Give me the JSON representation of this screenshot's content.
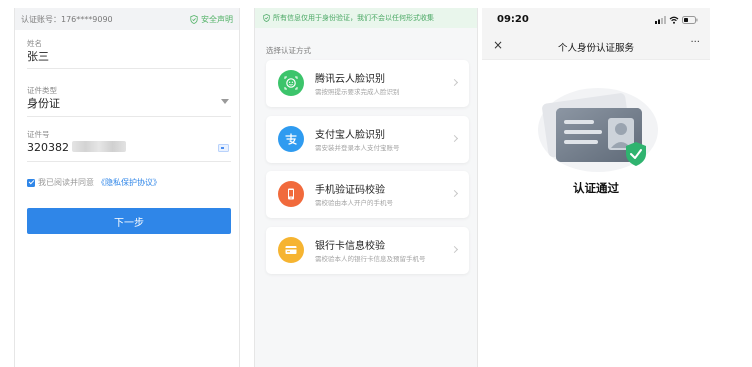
{
  "form": {
    "account_label": "认证账号：",
    "account_value": "176****9090",
    "security_notice": "安全声明",
    "name": {
      "label": "姓名",
      "value": "张三"
    },
    "id_type": {
      "label": "证件类型",
      "value": "身份证"
    },
    "id_number": {
      "label": "证件号",
      "value": "320382"
    },
    "agreement_prefix": "我已阅读并同意",
    "agreement_link": "《隐私保护协议》",
    "next_button": "下一步"
  },
  "methods": {
    "notice": "所有信息仅用于身份验证，我们不会以任何形式收集",
    "section_title": "选择认证方式",
    "items": [
      {
        "title": "腾讯云人脸识别",
        "subtitle": "需按照提示要求完成人脸识别",
        "icon": "face-scan-icon",
        "color": "#3cc46b"
      },
      {
        "title": "支付宝人脸识别",
        "subtitle": "需安装并登录本人支付宝账号",
        "icon": "alipay-icon",
        "color": "#2f9bf0"
      },
      {
        "title": "手机验证码校验",
        "subtitle": "需校验由本人开户的手机号",
        "icon": "phone-icon",
        "color": "#f16a3c"
      },
      {
        "title": "银行卡信息校验",
        "subtitle": "需校验本人的银行卡信息及预留手机号",
        "icon": "bank-card-icon",
        "color": "#f6b431"
      }
    ]
  },
  "result": {
    "time": "09:20",
    "nav_title": "个人身份认证服务",
    "close_icon": "×",
    "more_icon": "···",
    "success_text": "认证通过"
  },
  "colors": {
    "primary": "#2f86e8",
    "success": "#52b266"
  }
}
